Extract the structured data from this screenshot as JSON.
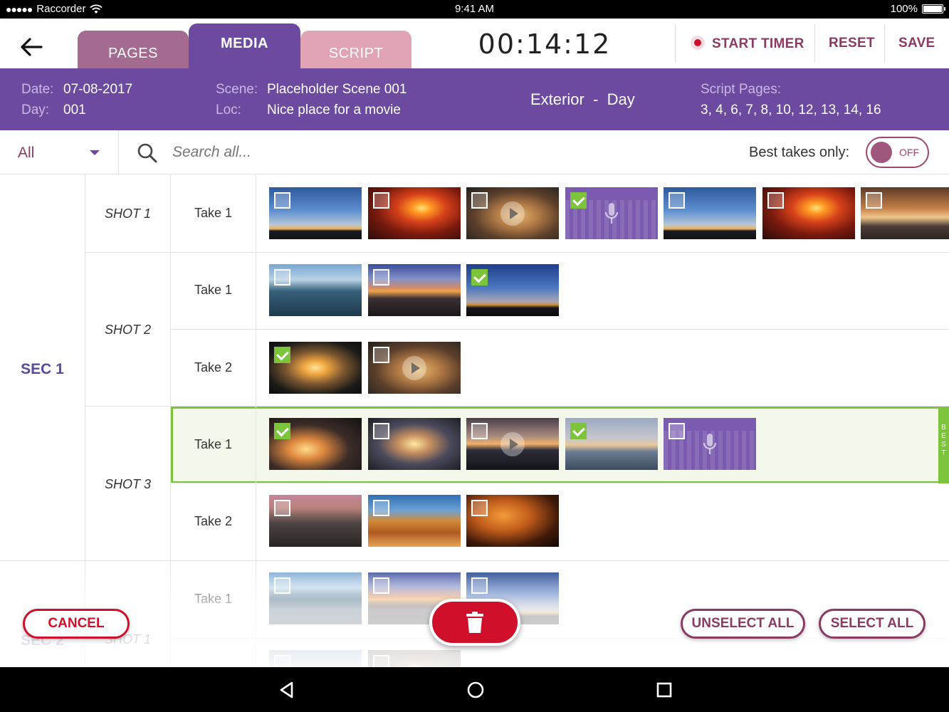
{
  "status_bar": {
    "carrier": "Raccorder",
    "signal": "●●●●●",
    "time": "9:41 AM",
    "battery": "100%"
  },
  "header": {
    "tabs": [
      {
        "label": "PAGES",
        "active": false
      },
      {
        "label": "MEDIA",
        "active": true
      },
      {
        "label": "SCRIPT",
        "active": false
      }
    ],
    "timer": "00:14:12",
    "start_timer_label": "START TIMER",
    "reset_label": "RESET",
    "save_label": "SAVE"
  },
  "info": {
    "date_label": "Date:",
    "date": "07-08-2017",
    "day_label": "Day:",
    "day": "001",
    "scene_label": "Scene:",
    "scene": "Placeholder Scene 001",
    "loc_label": "Loc:",
    "loc": "Nice place for a movie",
    "setting": "Exterior  -  Day",
    "script_pages_label": "Script Pages:",
    "script_pages": "3, 4, 6, 7, 8, 10, 12, 13, 14, 16"
  },
  "filter": {
    "selected": "All",
    "search_placeholder": "Search all...",
    "best_takes_label": "Best takes only:",
    "best_takes_state": "OFF"
  },
  "grid": {
    "sections": [
      {
        "label": "SEC 1"
      },
      {
        "label": "SEC 2"
      }
    ],
    "shots": [
      "SHOT 1",
      "SHOT 2",
      "SHOT 3",
      "SHOT 1"
    ],
    "takes": [
      "Take 1",
      "Take 1",
      "Take 2",
      "Take 1",
      "Take 2",
      "Take 1"
    ],
    "best_tag": [
      "B",
      "E",
      "S",
      "T"
    ],
    "rows": [
      {
        "media": [
          {
            "kind": "image",
            "bg": "sky",
            "checked": false
          },
          {
            "kind": "image",
            "bg": "fire",
            "checked": false
          },
          {
            "kind": "video",
            "bg": "cloud",
            "checked": false
          },
          {
            "kind": "audio",
            "bg": "audio",
            "checked": true
          },
          {
            "kind": "image",
            "bg": "sky",
            "checked": false
          },
          {
            "kind": "image",
            "bg": "fire",
            "checked": false
          },
          {
            "kind": "image",
            "bg": "cloud2",
            "checked": false
          }
        ]
      },
      {
        "media": [
          {
            "kind": "image",
            "bg": "kayak",
            "checked": false
          },
          {
            "kind": "image",
            "bg": "dusk",
            "checked": false
          },
          {
            "kind": "image",
            "bg": "blue",
            "checked": true
          }
        ]
      },
      {
        "media": [
          {
            "kind": "image",
            "bg": "silh",
            "checked": true
          },
          {
            "kind": "video",
            "bg": "cloud",
            "checked": false
          }
        ]
      },
      {
        "best": true,
        "media": [
          {
            "kind": "image",
            "bg": "tree",
            "checked": true
          },
          {
            "kind": "image",
            "bg": "rock",
            "checked": false
          },
          {
            "kind": "video",
            "bg": "sea",
            "checked": false
          },
          {
            "kind": "image",
            "bg": "swing",
            "checked": true
          },
          {
            "kind": "audio",
            "bg": "audio",
            "checked": false
          }
        ]
      },
      {
        "media": [
          {
            "kind": "image",
            "bg": "city",
            "checked": false
          },
          {
            "kind": "image",
            "bg": "butte",
            "checked": false
          },
          {
            "kind": "image",
            "bg": "orange",
            "checked": false
          }
        ]
      },
      {
        "media": [
          {
            "kind": "image",
            "bg": "kayak",
            "checked": false
          },
          {
            "kind": "image",
            "bg": "dusk",
            "checked": false
          },
          {
            "kind": "image",
            "bg": "blue",
            "checked": false
          }
        ]
      },
      {
        "media": [
          {
            "kind": "image",
            "bg": "lake",
            "checked": false
          },
          {
            "kind": "video",
            "bg": "cloud",
            "checked": false
          }
        ]
      }
    ]
  },
  "actions": {
    "cancel_label": "CANCEL",
    "unselect_all_label": "UNSELECT ALL",
    "select_all_label": "SELECT ALL",
    "delete_icon": "trash-icon"
  },
  "colors": {
    "purple": "#6b4aa0",
    "plum": "#8a3a63",
    "red": "#d0102a",
    "green": "#7cc43c"
  }
}
